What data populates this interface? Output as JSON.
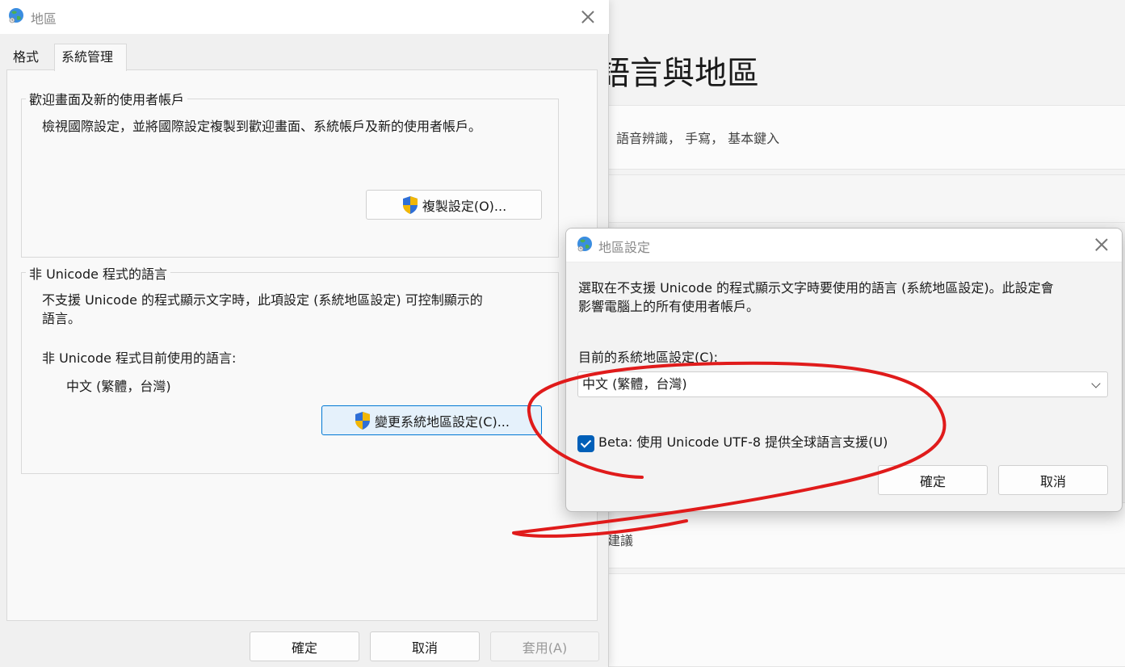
{
  "background_window": {
    "title_partial": "語言與地區",
    "subtitle_partial": "語音辨識， 手寫， 基本鍵入",
    "suggestion_partial": "建議"
  },
  "region_dialog": {
    "title": "地區",
    "tabs": [
      {
        "label": "格式",
        "selected": false
      },
      {
        "label": "系統管理",
        "selected": true
      }
    ],
    "welcome_group": {
      "label": "歡迎畫面及新的使用者帳戶",
      "description": "檢視國際設定，並將國際設定複製到歡迎畫面、系統帳戶及新的使用者帳戶。",
      "copy_button": "複製設定(O)..."
    },
    "non_unicode_group": {
      "label": "非 Unicode 程式的語言",
      "description_line1": "不支援 Unicode 的程式顯示文字時，此項設定 (系統地區設定) 可控制顯示的",
      "description_line2": "語言。",
      "current_label": "非 Unicode 程式目前使用的語言:",
      "current_value": "中文 (繁體，台灣)",
      "change_button": "變更系統地區設定(C)..."
    },
    "footer": {
      "ok": "確定",
      "cancel": "取消",
      "apply": "套用(A)"
    }
  },
  "region_settings_dialog": {
    "title": "地區設定",
    "description_line1": "選取在不支援 Unicode 的程式顯示文字時要使用的語言 (系統地區設定)。此設定會",
    "description_line2": "影響電腦上的所有使用者帳戶。",
    "current_locale_label": "目前的系統地區設定(C):",
    "current_locale_value": "中文 (繁體，台灣)",
    "beta_checkbox_label": "Beta: 使用 Unicode UTF-8 提供全球語言支援(U)",
    "beta_checked": true,
    "ok": "確定",
    "cancel": "取消"
  },
  "colors": {
    "accent": "#005fb8",
    "annotation_red": "#e01b1b",
    "shield_blue": "#2f6fd6",
    "shield_yellow": "#f2b705"
  }
}
